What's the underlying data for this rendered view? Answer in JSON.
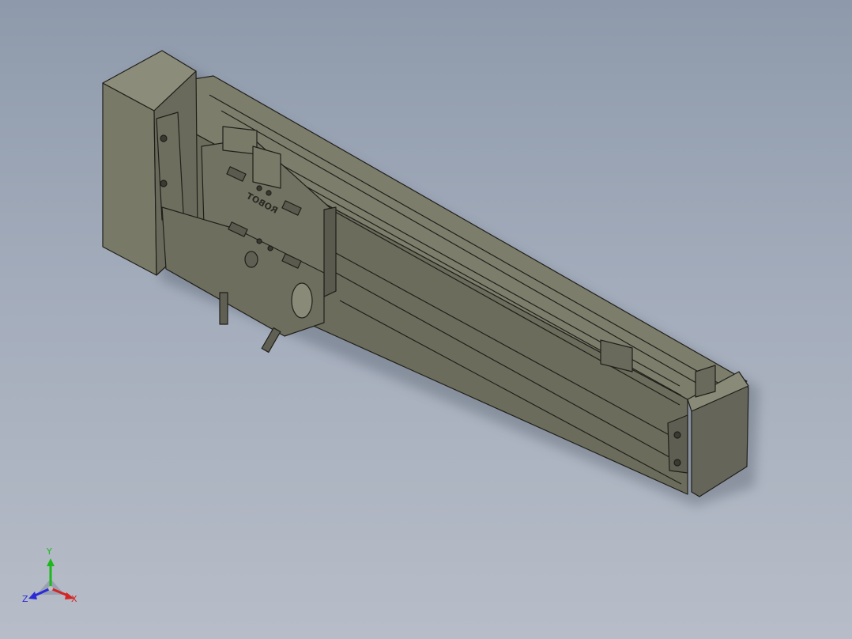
{
  "viewport": {
    "background_top": "#8e9aab",
    "background_bottom": "#b7bdc8"
  },
  "model": {
    "carriage_logo_text": "ROBOT",
    "body_color": "#6f6f5f",
    "edge_color": "#1f1f1a"
  },
  "triad": {
    "x_label": "X",
    "y_label": "Y",
    "z_label": "Z",
    "x_color": "#d42424",
    "y_color": "#1cb81c",
    "z_color": "#2a2ad8"
  }
}
